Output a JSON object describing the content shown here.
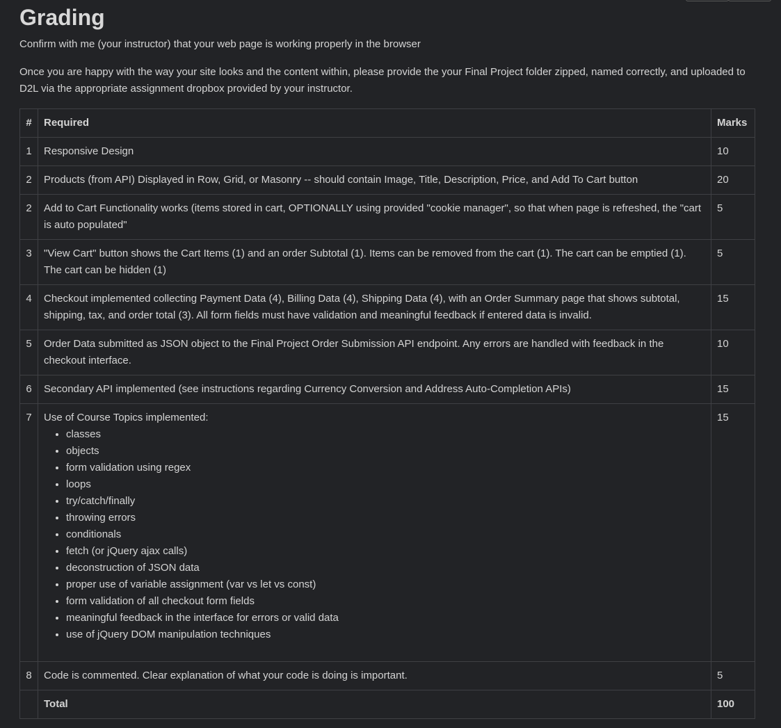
{
  "heading": "Grading",
  "intro": "Confirm with me (your instructor) that your web page is working properly in the browser",
  "instructions": "Once you are happy with the way your site looks and the content within, please provide the your Final Project folder zipped, named correctly, and uploaded to D2L via the appropriate assignment dropbox provided by your instructor.",
  "table": {
    "headers": {
      "num": "#",
      "required": "Required",
      "marks": "Marks"
    },
    "rows": [
      {
        "num": "1",
        "required": "Responsive Design",
        "marks": "10"
      },
      {
        "num": "2",
        "required": "Products (from API) Displayed in Row, Grid, or Masonry -- should contain Image, Title, Description, Price, and Add To Cart button",
        "marks": "20"
      },
      {
        "num": "2",
        "required": "Add to Cart Functionality works (items stored in cart, OPTIONALLY using provided \"cookie manager\", so that when page is refreshed, the \"cart is auto populated\"",
        "marks": "5"
      },
      {
        "num": "3",
        "required": "\"View Cart\" button shows the Cart Items (1) and an order Subtotal (1). Items can be removed from the cart (1). The cart can be emptied (1). The cart can be hidden (1)",
        "marks": "5"
      },
      {
        "num": "4",
        "required": "Checkout implemented collecting Payment Data (4), Billing Data (4), Shipping Data (4), with an Order Summary page that shows subtotal, shipping, tax, and order total (3). All form fields must have validation and meaningful feedback if entered data is invalid.",
        "marks": "15"
      },
      {
        "num": "5",
        "required": "Order Data submitted as JSON object to the Final Project Order Submission API endpoint. Any errors are handled with feedback in the checkout interface.",
        "marks": "10"
      },
      {
        "num": "6",
        "required": "Secondary API implemented (see instructions regarding Currency Conversion and Address Auto-Completion APIs)",
        "marks": "15"
      },
      {
        "num": "7",
        "required": "Use of Course Topics implemented:",
        "marks": "15"
      },
      {
        "num": "8",
        "required": "Code is commented. Clear explanation of what your code is doing is important.",
        "marks": "5"
      }
    ],
    "topics": [
      "classes",
      "objects",
      "form validation using regex",
      "loops",
      "try/catch/finally",
      "throwing errors",
      "conditionals",
      "fetch (or jQuery ajax calls)",
      "deconstruction of JSON data",
      "proper use of variable assignment (var vs let vs const)",
      "form validation of all checkout form fields",
      "meaningful feedback in the interface for errors or valid data",
      "use of jQuery DOM manipulation techniques"
    ],
    "total": {
      "num": "",
      "label": "Total",
      "marks": "100"
    }
  }
}
